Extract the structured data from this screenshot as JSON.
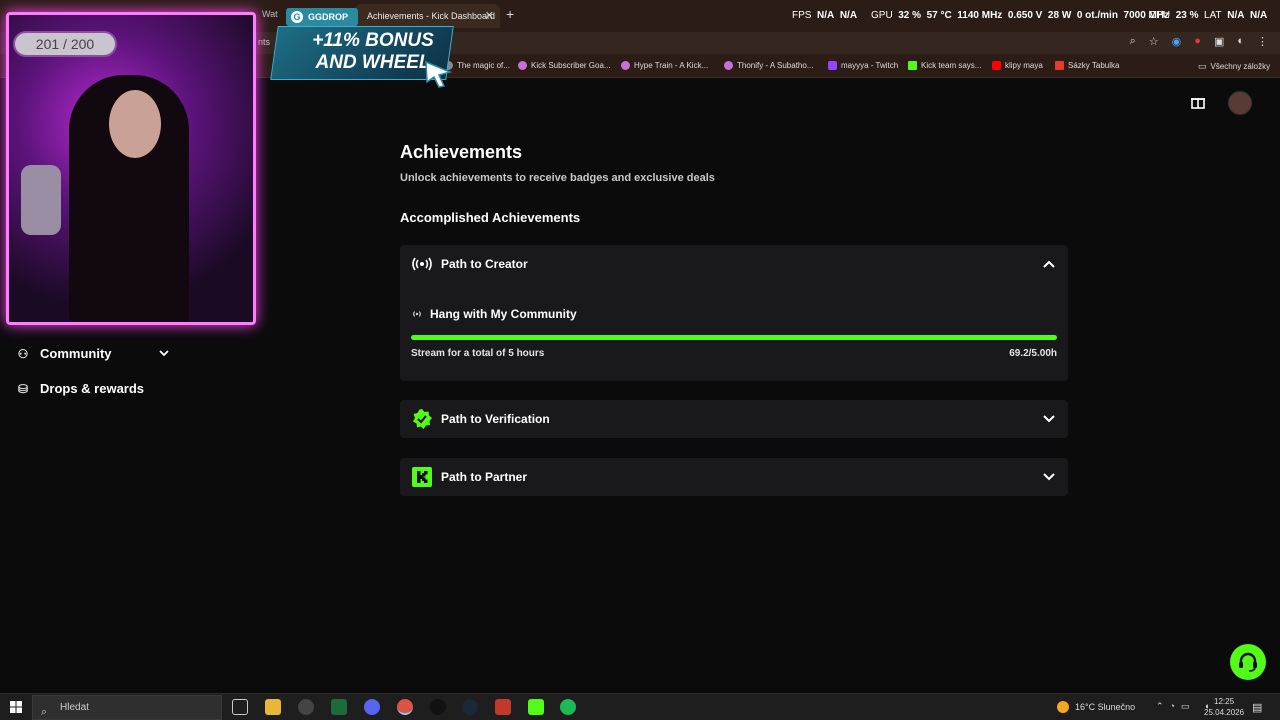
{
  "browser": {
    "active_tab_title": "Achievements - Kick Dashboard",
    "prev_tab_fragment": "Wat",
    "address_fragment": "nts",
    "new_tab": "+",
    "close_tab": "✕",
    "osd": {
      "fps_label": "FPS",
      "fps_val1": "N/A",
      "fps_val2": "N/A",
      "gpu_label": "GPU",
      "gpu_load": "32 %",
      "gpu_temp": "57 °C",
      "gpu_clock": "1140 MHz",
      "gpu_volt": "0.650 V",
      "gpu_power": "28 W",
      "gpu_fan": "0 ot./min",
      "gpu_mem": "7000 MHz",
      "cpu_label": "CPU",
      "cpu_load": "23 %",
      "lat_label": "LAT",
      "lat_val1": "N/A",
      "lat_val2": "N/A"
    },
    "bookmarks": [
      {
        "label": "The magic of...",
        "icon": "generic-icon",
        "color": "#888888"
      },
      {
        "label": "Kick Subscriber Goa...",
        "icon": "streamelements-icon",
        "color": "#c86fd8"
      },
      {
        "label": "Hype Train - A Kick...",
        "icon": "streamelements-icon",
        "color": "#c86fd8"
      },
      {
        "label": "Thonify - A Subatho...",
        "icon": "streamelements-icon",
        "color": "#c86fd8"
      },
      {
        "label": "mayyya - Twitch",
        "icon": "twitch-icon",
        "color": "#9146ff"
      },
      {
        "label": "Kick team says...",
        "icon": "kick-icon",
        "color": "#53fc18"
      },
      {
        "label": "klipy maya",
        "icon": "youtube-icon",
        "color": "#ff0000"
      },
      {
        "label": "Sázky Tabulka",
        "icon": "sheet-icon",
        "color": "#e33b2e"
      }
    ],
    "bookmarks_folder": "Všechny záložky"
  },
  "overlay": {
    "sub_count": "201 / 200",
    "ad_tag": "GGDROP",
    "ad_line1": "+11% BONUS",
    "ad_line2": "AND WHEEL"
  },
  "sidebar": {
    "items": [
      {
        "label": "Community",
        "icon": "community-icon"
      },
      {
        "label": "Drops & rewards",
        "icon": "drops-icon"
      }
    ]
  },
  "main": {
    "title": "Achievements",
    "subtitle": "Unlock achievements to receive badges and exclusive deals",
    "section_title": "Accomplished Achievements",
    "paths": [
      {
        "label": "Path to Creator",
        "expanded": true,
        "icon": "broadcast-icon"
      },
      {
        "label": "Path to Verification",
        "expanded": false,
        "icon": "verified-badge-icon"
      },
      {
        "label": "Path to Partner",
        "expanded": false,
        "icon": "kick-logo-icon"
      }
    ],
    "creator_achievement": {
      "title": "Hang with My Community",
      "requirement": "Stream for a total of 5 hours",
      "progress_text": "69.2/5.00h",
      "progress_fraction": 1.0
    }
  },
  "taskbar": {
    "search_placeholder": "Hledat",
    "weather": "16°C  Slunečno",
    "time": "12:25",
    "date": "25.04.2026"
  },
  "colors": {
    "accent": "#53fc18",
    "card_bg": "#19191b",
    "page_bg": "#0b0b0c"
  }
}
